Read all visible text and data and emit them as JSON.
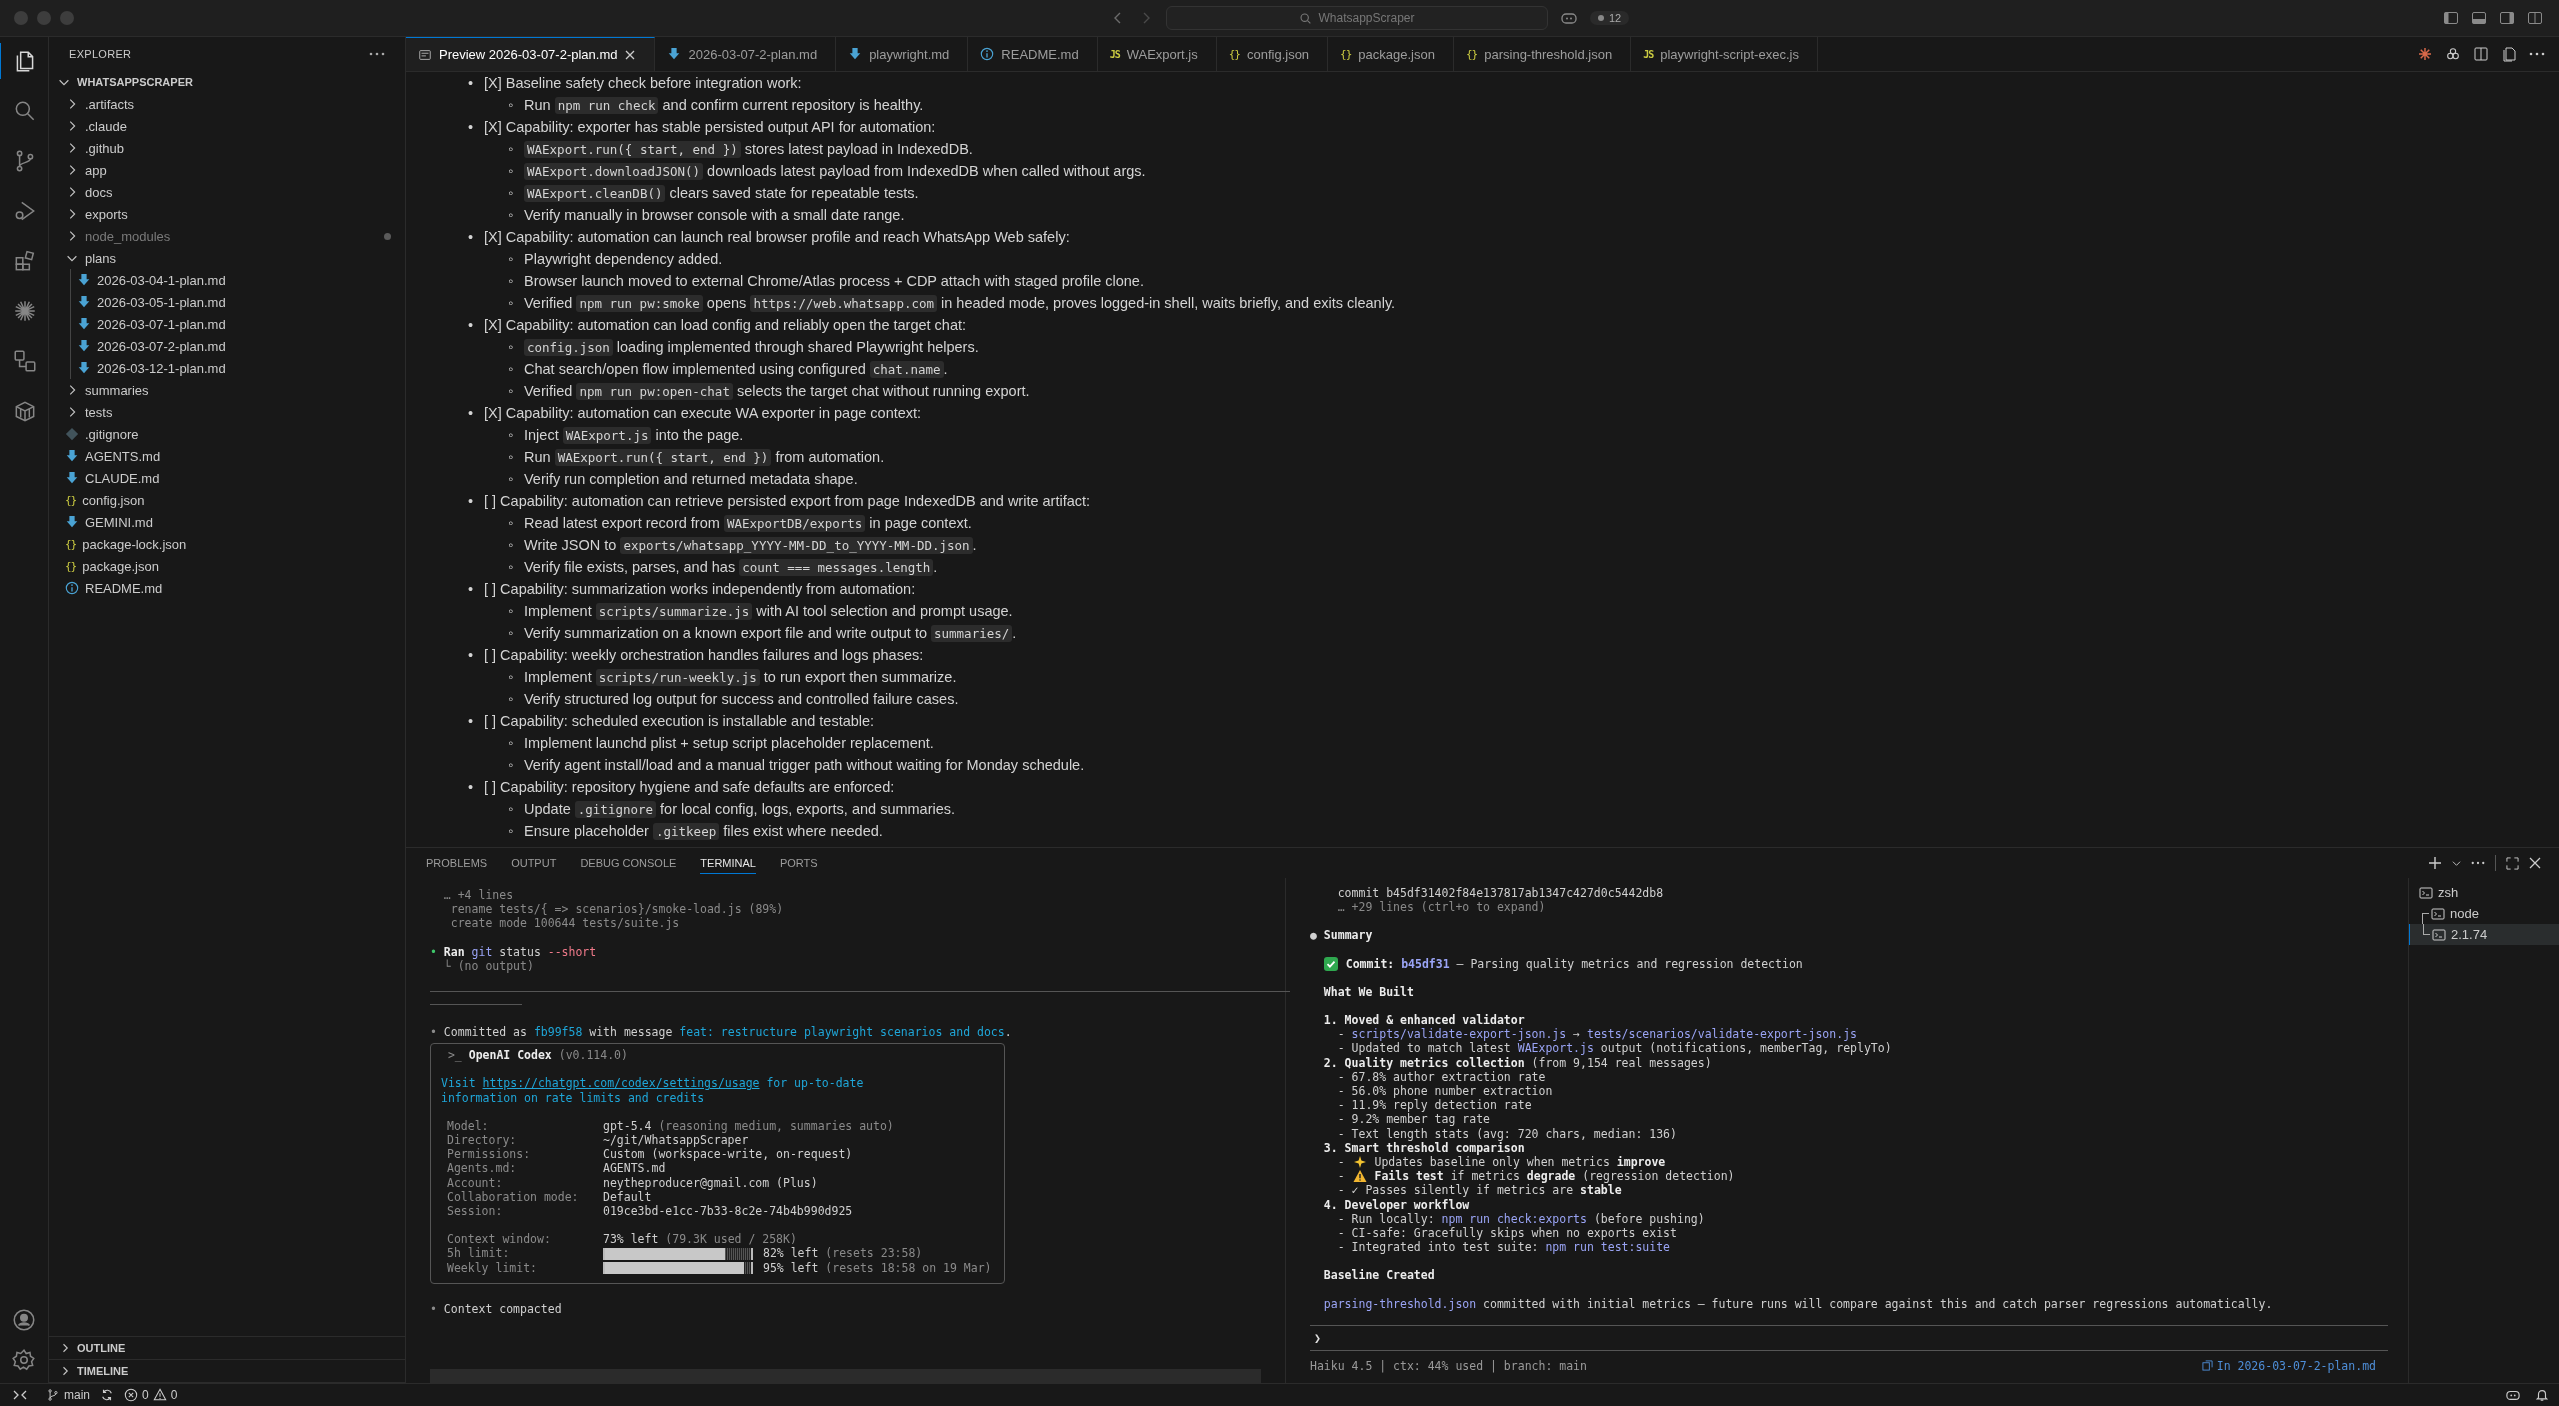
{
  "window": {
    "title": "WhatsappScraper",
    "badge": "12"
  },
  "activity_bar": {
    "items": [
      {
        "kind": "files",
        "selected": true
      },
      {
        "kind": "search",
        "selected": false
      },
      {
        "kind": "source-control",
        "selected": false
      },
      {
        "kind": "run",
        "selected": false
      },
      {
        "kind": "extensions",
        "selected": false
      },
      {
        "kind": "asterisk",
        "selected": false
      },
      {
        "kind": "remote",
        "selected": false
      },
      {
        "kind": "container",
        "selected": false
      }
    ]
  },
  "explorer": {
    "title": "EXPLORER",
    "tree": [
      {
        "name": "WHATSAPPSCRAPER",
        "kind": "root",
        "expanded": true,
        "dimmed": false,
        "children": [
          {
            "name": ".artifacts",
            "kind": "folder",
            "expanded": false,
            "dimmed": false
          },
          {
            "name": ".claude",
            "kind": "folder",
            "expanded": false,
            "dimmed": false
          },
          {
            "name": ".github",
            "kind": "folder",
            "expanded": false,
            "dimmed": false
          },
          {
            "name": "app",
            "kind": "folder",
            "expanded": false,
            "dimmed": false
          },
          {
            "name": "docs",
            "kind": "folder",
            "expanded": false,
            "dimmed": false
          },
          {
            "name": "exports",
            "kind": "folder",
            "expanded": false,
            "dimmed": false
          },
          {
            "name": "node_modules",
            "kind": "folder",
            "expanded": false,
            "dimmed": true
          },
          {
            "name": "plans",
            "kind": "folder",
            "expanded": true,
            "dimmed": false,
            "children": [
              {
                "name": "2026-03-04-1-plan.md",
                "kind": "md",
                "dimmed": false
              },
              {
                "name": "2026-03-05-1-plan.md",
                "kind": "md",
                "dimmed": false
              },
              {
                "name": "2026-03-07-1-plan.md",
                "kind": "md",
                "dimmed": false
              },
              {
                "name": "2026-03-07-2-plan.md",
                "kind": "md",
                "dimmed": false
              },
              {
                "name": "2026-03-12-1-plan.md",
                "kind": "md",
                "dimmed": false
              }
            ]
          },
          {
            "name": "summaries",
            "kind": "folder",
            "expanded": false,
            "dimmed": false
          },
          {
            "name": "tests",
            "kind": "folder",
            "expanded": false,
            "dimmed": false
          },
          {
            "name": ".gitignore",
            "kind": "git",
            "dimmed": false
          },
          {
            "name": "AGENTS.md",
            "kind": "md",
            "dimmed": false
          },
          {
            "name": "CLAUDE.md",
            "kind": "md",
            "dimmed": false
          },
          {
            "name": "config.json",
            "kind": "json",
            "glyph": "{}",
            "dimmed": false
          },
          {
            "name": "GEMINI.md",
            "kind": "md",
            "dimmed": false
          },
          {
            "name": "package-lock.json",
            "kind": "json",
            "glyph": "{}",
            "dimmed": false
          },
          {
            "name": "package.json",
            "kind": "json",
            "glyph": "{}",
            "dimmed": false
          },
          {
            "name": "README.md",
            "kind": "info",
            "dimmed": false
          }
        ]
      }
    ],
    "sections": [
      {
        "title": "OUTLINE",
        "expanded": false
      },
      {
        "title": "TIMELINE",
        "expanded": false
      }
    ]
  },
  "editor": {
    "tabs": [
      {
        "label": "Preview 2026-03-07-2-plan.md",
        "kind": "preview",
        "selected": true
      },
      {
        "label": "2026-03-07-2-plan.md",
        "kind": "md",
        "selected": false
      },
      {
        "label": "playwright.md",
        "kind": "md",
        "selected": false
      },
      {
        "label": "README.md",
        "kind": "info",
        "selected": false
      },
      {
        "label": "WAExport.js",
        "kind": "js",
        "glyph": "JS",
        "selected": false
      },
      {
        "label": "config.json",
        "kind": "json",
        "glyph": "{}",
        "selected": false
      },
      {
        "label": "package.json",
        "kind": "json",
        "glyph": "{}",
        "selected": false
      },
      {
        "label": "parsing-threshold.json",
        "kind": "json",
        "glyph": "{}",
        "selected": false
      },
      {
        "label": "playwright-script-exec.js",
        "kind": "js",
        "glyph": "JS",
        "selected": false
      }
    ],
    "items": [
      {
        "marker": "•",
        "text": "[X] Baseline safety check before integration work:",
        "children": [
          {
            "marker": "◦",
            "parts": [
              {
                "text": "Run "
              },
              {
                "code": "npm run check"
              },
              {
                "text": " and confirm current repository is healthy."
              }
            ]
          }
        ]
      },
      {
        "marker": "•",
        "text": "[X] Capability: exporter has stable persisted output API for automation:",
        "children": [
          {
            "marker": "◦",
            "parts": [
              {
                "code": "WAExport.run({ start, end })"
              },
              {
                "text": " stores latest payload in IndexedDB."
              }
            ]
          },
          {
            "marker": "◦",
            "parts": [
              {
                "code": "WAExport.downloadJSON()"
              },
              {
                "text": " downloads latest payload from IndexedDB when called without args."
              }
            ]
          },
          {
            "marker": "◦",
            "parts": [
              {
                "code": "WAExport.cleanDB()"
              },
              {
                "text": " clears saved state for repeatable tests."
              }
            ]
          },
          {
            "marker": "◦",
            "parts": [
              {
                "text": "Verify manually in browser console with a small date range."
              }
            ]
          }
        ]
      },
      {
        "marker": "•",
        "text": "[X] Capability: automation can launch real browser profile and reach WhatsApp Web safely:",
        "children": [
          {
            "marker": "◦",
            "parts": [
              {
                "text": "Playwright dependency added."
              }
            ]
          },
          {
            "marker": "◦",
            "parts": [
              {
                "text": "Browser launch moved to external Chrome/Atlas process + CDP attach with staged profile clone."
              }
            ]
          },
          {
            "marker": "◦",
            "parts": [
              {
                "text": "Verified "
              },
              {
                "code": "npm run pw:smoke"
              },
              {
                "text": " opens "
              },
              {
                "code": "https://web.whatsapp.com"
              },
              {
                "text": " in headed mode, proves logged-in shell, waits briefly, and exits cleanly."
              }
            ]
          }
        ]
      },
      {
        "marker": "•",
        "text": "[X] Capability: automation can load config and reliably open the target chat:",
        "children": [
          {
            "marker": "◦",
            "parts": [
              {
                "code": "config.json"
              },
              {
                "text": " loading implemented through shared Playwright helpers."
              }
            ]
          },
          {
            "marker": "◦",
            "parts": [
              {
                "text": "Chat search/open flow implemented using configured "
              },
              {
                "code": "chat.name"
              },
              {
                "text": "."
              }
            ]
          },
          {
            "marker": "◦",
            "parts": [
              {
                "text": "Verified "
              },
              {
                "code": "npm run pw:open-chat"
              },
              {
                "text": " selects the target chat without running export."
              }
            ]
          }
        ]
      },
      {
        "marker": "•",
        "text": "[X] Capability: automation can execute WA exporter in page context:",
        "children": [
          {
            "marker": "◦",
            "parts": [
              {
                "text": "Inject "
              },
              {
                "code": "WAExport.js"
              },
              {
                "text": " into the page."
              }
            ]
          },
          {
            "marker": "◦",
            "parts": [
              {
                "text": "Run "
              },
              {
                "code": "WAExport.run({ start, end })"
              },
              {
                "text": " from automation."
              }
            ]
          },
          {
            "marker": "◦",
            "parts": [
              {
                "text": "Verify run completion and returned metadata shape."
              }
            ]
          }
        ]
      },
      {
        "marker": "•",
        "text": "[ ] Capability: automation can retrieve persisted export from page IndexedDB and write artifact:",
        "children": [
          {
            "marker": "◦",
            "parts": [
              {
                "text": "Read latest export record from "
              },
              {
                "code": "WAExportDB/exports"
              },
              {
                "text": " in page context."
              }
            ]
          },
          {
            "marker": "◦",
            "parts": [
              {
                "text": "Write JSON to "
              },
              {
                "code": "exports/whatsapp_YYYY-MM-DD_to_YYYY-MM-DD.json"
              },
              {
                "text": "."
              }
            ]
          },
          {
            "marker": "◦",
            "parts": [
              {
                "text": "Verify file exists, parses, and has "
              },
              {
                "code": "count === messages.length"
              },
              {
                "text": "."
              }
            ]
          }
        ]
      },
      {
        "marker": "•",
        "text": "[ ] Capability: summarization works independently from automation:",
        "children": [
          {
            "marker": "◦",
            "parts": [
              {
                "text": "Implement "
              },
              {
                "code": "scripts/summarize.js"
              },
              {
                "text": " with AI tool selection and prompt usage."
              }
            ]
          },
          {
            "marker": "◦",
            "parts": [
              {
                "text": "Verify summarization on a known export file and write output to "
              },
              {
                "code": "summaries/"
              },
              {
                "text": "."
              }
            ]
          }
        ]
      },
      {
        "marker": "•",
        "text": "[ ] Capability: weekly orchestration handles failures and logs phases:",
        "children": [
          {
            "marker": "◦",
            "parts": [
              {
                "text": "Implement "
              },
              {
                "code": "scripts/run-weekly.js"
              },
              {
                "text": " to run export then summarize."
              }
            ]
          },
          {
            "marker": "◦",
            "parts": [
              {
                "text": "Verify structured log output for success and controlled failure cases."
              }
            ]
          }
        ]
      },
      {
        "marker": "•",
        "text": "[ ] Capability: scheduled execution is installable and testable:",
        "children": [
          {
            "marker": "◦",
            "parts": [
              {
                "text": "Implement launchd plist + setup script placeholder replacement."
              }
            ]
          },
          {
            "marker": "◦",
            "parts": [
              {
                "text": "Verify agent install/load and a manual trigger path without waiting for Monday schedule."
              }
            ]
          }
        ]
      },
      {
        "marker": "•",
        "text": "[ ] Capability: repository hygiene and safe defaults are enforced:",
        "children": [
          {
            "marker": "◦",
            "parts": [
              {
                "text": "Update "
              },
              {
                "code": ".gitignore"
              },
              {
                "text": " for local config, logs, exports, and summaries."
              }
            ]
          },
          {
            "marker": "◦",
            "parts": [
              {
                "text": "Ensure placeholder "
              },
              {
                "code": ".gitkeep"
              },
              {
                "text": " files exist where needed."
              }
            ]
          }
        ]
      }
    ]
  },
  "panel": {
    "tabs": [
      {
        "label": "PROBLEMS",
        "selected": false
      },
      {
        "label": "OUTPUT",
        "selected": false
      },
      {
        "label": "DEBUG CONSOLE",
        "selected": false
      },
      {
        "label": "TERMINAL",
        "selected": true
      },
      {
        "label": "PORTS",
        "selected": false
      }
    ],
    "left_terminal": {
      "blocks": [
        {
          "kind": "lines",
          "lines": [
            [
              {
                "text": "  … +4 lines",
                "kind": "dim"
              }
            ],
            [
              {
                "text": "   rename tests/{ => scenarios}/smoke-load.js (89%)",
                "kind": "dim"
              }
            ],
            [
              {
                "text": "   create mode 100644 tests/suite.js",
                "kind": "dim"
              }
            ]
          ]
        },
        {
          "kind": "lines",
          "lines": [
            [
              {
                "text": "• ",
                "kind": "green"
              },
              {
                "text": "Ran",
                "kind": "bold"
              },
              {
                "text": " git",
                "kind": "blue"
              },
              {
                "text": " status",
                "kind": "plain"
              },
              {
                "text": " --short",
                "kind": "pink"
              }
            ],
            [
              {
                "text": "  └ (no output)",
                "kind": "dim"
              }
            ]
          ]
        },
        {
          "kind": "rule"
        },
        {
          "kind": "lines",
          "lines": [
            [
              {
                "text": "• ",
                "kind": "dim"
              },
              {
                "text": "Committed as ",
                "kind": "plain"
              },
              {
                "text": "fb99f58",
                "kind": "cyan"
              },
              {
                "text": " with message ",
                "kind": "plain"
              },
              {
                "text": "feat: restructure playwright scenarios and docs",
                "kind": "cyan"
              },
              {
                "text": ".",
                "kind": "plain"
              }
            ]
          ]
        },
        {
          "kind": "box",
          "header": [
            {
              "text": " >_ ",
              "kind": "dim"
            },
            {
              "text": "OpenAI Codex",
              "kind": "bold"
            },
            {
              "text": " (v0.114.0)",
              "kind": "dim"
            }
          ],
          "notice": [
            [
              {
                "text": "Visit ",
                "kind": "cyan"
              },
              {
                "text": "https://chatgpt.com/codex/settings/usage",
                "kind": "url"
              },
              {
                "text": " for up-to-date",
                "kind": "cyan"
              }
            ],
            [
              {
                "text": "information on rate limits and credits",
                "kind": "cyan"
              }
            ]
          ],
          "info_rows": [
            {
              "label": "Model:",
              "value": [
                {
                  "text": "gpt-5.4",
                  "kind": "plain"
                },
                {
                  "text": " (reasoning medium, summaries auto)",
                  "kind": "dim"
                }
              ]
            },
            {
              "label": "Directory:",
              "value": [
                {
                  "text": "~/git/WhatsappScraper",
                  "kind": "plain"
                }
              ]
            },
            {
              "label": "Permissions:",
              "value": [
                {
                  "text": "Custom (workspace-write, on-request)",
                  "kind": "plain"
                }
              ]
            },
            {
              "label": "Agents.md:",
              "value": [
                {
                  "text": "AGENTS.md",
                  "kind": "plain"
                }
              ]
            },
            {
              "label": "Account:",
              "value": [
                {
                  "text": "neytheproducer@gmail.com (Plus)",
                  "kind": "plain"
                }
              ]
            },
            {
              "label": "Collaboration mode:",
              "value": [
                {
                  "text": "Default",
                  "kind": "plain"
                }
              ]
            },
            {
              "label": "Session:",
              "value": [
                {
                  "text": "019ce3bd-e1cc-7b33-8c2e-74b4b990d925",
                  "kind": "plain"
                }
              ]
            }
          ],
          "usage_rows": [
            {
              "label": "Context window:",
              "value": [
                {
                  "text": "73% left",
                  "kind": "plain"
                },
                {
                  "text": " (79.3K used / 258K)",
                  "kind": "dim"
                }
              ]
            },
            {
              "label": "5h limit:",
              "level": 0.82,
              "value": [
                {
                  "text": "82% left",
                  "kind": "plain"
                },
                {
                  "text": " (resets 23:58)",
                  "kind": "dim"
                }
              ]
            },
            {
              "label": "Weekly limit:",
              "level": 0.95,
              "value": [
                {
                  "text": "95% left",
                  "kind": "plain"
                },
                {
                  "text": " (resets 18:58 on 19 Mar)",
                  "kind": "dim"
                }
              ]
            }
          ]
        },
        {
          "kind": "lines",
          "lines": [
            [
              {
                "text": "• ",
                "kind": "dim"
              },
              {
                "text": "Context compacted",
                "kind": "plain"
              }
            ]
          ]
        }
      ]
    },
    "right_terminal": {
      "blocks": [
        {
          "kind": "lines",
          "lines": [
            [
              {
                "text": "    commit b45df31402f84e137817ab1347c427d0c5442db8",
                "kind": "plain"
              }
            ],
            [
              {
                "text": "    … +29 lines (ctrl+o to expand)",
                "kind": "dim"
              }
            ]
          ]
        },
        {
          "kind": "lines",
          "lines": [
            [
              {
                "text": "● ",
                "kind": "plain"
              },
              {
                "text": "Summary",
                "kind": "bold"
              }
            ]
          ]
        },
        {
          "kind": "lines",
          "lines": [
            [
              {
                "kind": "check-emoji"
              },
              {
                "text": " Commit:",
                "kind": "bold"
              },
              {
                "text": " b45df31",
                "kind": "boldblue"
              },
              {
                "text": " — Parsing quality metrics and regression detection",
                "kind": "plain"
              }
            ]
          ]
        },
        {
          "kind": "lines",
          "lines": [
            [
              {
                "text": "  What We Built",
                "kind": "bold"
              }
            ]
          ]
        },
        {
          "kind": "lines",
          "lines": [
            [
              {
                "text": "  1. Moved & enhanced validator",
                "kind": "bold"
              }
            ],
            [
              {
                "text": "    - ",
                "kind": "plain"
              },
              {
                "text": "scripts/validate-export-json.js",
                "kind": "blue"
              },
              {
                "text": " → ",
                "kind": "plain"
              },
              {
                "text": "tests/scenarios/validate-export-json.js",
                "kind": "blue"
              }
            ],
            [
              {
                "text": "    - Updated to match latest ",
                "kind": "plain"
              },
              {
                "text": "WAExport.js",
                "kind": "blue"
              },
              {
                "text": " output (notifications, memberTag, replyTo)",
                "kind": "plain"
              }
            ],
            [
              {
                "text": "  2. Quality metrics collection",
                "kind": "bold"
              },
              {
                "text": " (from 9,154 real messages)",
                "kind": "plain"
              }
            ],
            [
              {
                "text": "    - 67.8% author extraction rate",
                "kind": "plain"
              }
            ],
            [
              {
                "text": "    - 56.0% phone number extraction",
                "kind": "plain"
              }
            ],
            [
              {
                "text": "    - 11.9% reply detection rate",
                "kind": "plain"
              }
            ],
            [
              {
                "text": "    - 9.2% member tag rate",
                "kind": "plain"
              }
            ],
            [
              {
                "text": "    - Text length stats (avg: 720 chars, median: 136)",
                "kind": "plain"
              }
            ],
            [
              {
                "text": "  3. Smart threshold comparison",
                "kind": "bold"
              }
            ],
            [
              {
                "text": "    - ",
                "kind": "plain"
              },
              {
                "kind": "sparkle-emoji"
              },
              {
                "text": " Updates baseline only when metrics ",
                "kind": "plain"
              },
              {
                "text": "improve",
                "kind": "bold"
              }
            ],
            [
              {
                "text": "    - ",
                "kind": "plain"
              },
              {
                "kind": "warning-emoji"
              },
              {
                "text": " Fails test",
                "kind": "bold"
              },
              {
                "text": " if metrics ",
                "kind": "plain"
              },
              {
                "text": "degrade",
                "kind": "bold"
              },
              {
                "text": " (regression detection)",
                "kind": "plain"
              }
            ],
            [
              {
                "text": "    - ✓ Passes silently if metrics are ",
                "kind": "plain"
              },
              {
                "text": "stable",
                "kind": "bold"
              }
            ],
            [
              {
                "text": "  4. Developer workflow",
                "kind": "bold"
              }
            ],
            [
              {
                "text": "    - Run locally: ",
                "kind": "plain"
              },
              {
                "text": "npm run check:exports",
                "kind": "blue"
              },
              {
                "text": " (before pushing)",
                "kind": "plain"
              }
            ],
            [
              {
                "text": "    - CI-safe: Gracefully skips when no exports exist",
                "kind": "plain"
              }
            ],
            [
              {
                "text": "    - Integrated into test suite: ",
                "kind": "plain"
              },
              {
                "text": "npm run test:suite",
                "kind": "blue"
              }
            ]
          ]
        },
        {
          "kind": "lines",
          "lines": [
            [
              {
                "text": "  Baseline Created",
                "kind": "bold"
              }
            ]
          ]
        },
        {
          "kind": "lines",
          "lines": [
            [
              {
                "text": "  parsing-threshold.json",
                "kind": "blue"
              },
              {
                "text": " committed with initial metrics — future runs will compare against this and catch parser regressions automatically.",
                "kind": "plain"
              }
            ]
          ]
        }
      ],
      "prompt": "❯",
      "status": "Haiku 4.5 | ctx: 44% used | branch: main",
      "file_link": "In 2026-03-07-2-plan.md"
    },
    "terminals": [
      {
        "label": "zsh",
        "kind": "single",
        "selected": false
      },
      {
        "label": "node",
        "kind": "split-top",
        "selected": false
      },
      {
        "label": "2.1.74",
        "kind": "split-bottom",
        "selected": true
      }
    ]
  },
  "status_bar": {
    "branch": "main",
    "errors": "0",
    "warnings": "0"
  }
}
